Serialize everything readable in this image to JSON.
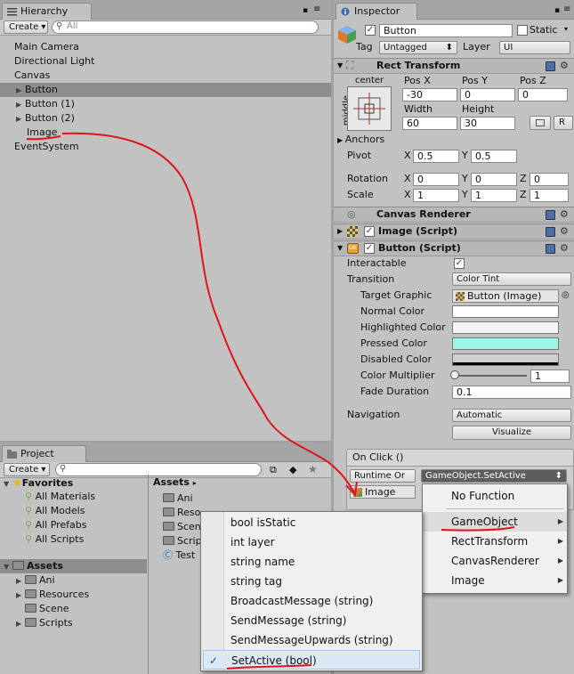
{
  "hierarchy": {
    "tab": "Hierarchy",
    "create": "Create",
    "search_placeholder": "All",
    "items": [
      {
        "label": "Main Camera"
      },
      {
        "label": "Directional Light"
      },
      {
        "label": "Canvas"
      },
      {
        "label": "Button"
      },
      {
        "label": "Button (1)"
      },
      {
        "label": "Button (2)"
      },
      {
        "label": "Image"
      },
      {
        "label": "EventSystem"
      }
    ]
  },
  "inspector": {
    "tab": "Inspector",
    "object_name": "Button",
    "static": "Static",
    "tag_label": "Tag",
    "tag_value": "Untagged",
    "layer_label": "Layer",
    "layer_value": "UI",
    "rect_transform": {
      "title": "Rect Transform",
      "anchor_h": "center",
      "anchor_v": "middle",
      "pos_x_label": "Pos X",
      "pos_y_label": "Pos Y",
      "pos_z_label": "Pos Z",
      "pos_x": "-30",
      "pos_y": "0",
      "pos_z": "0",
      "width_label": "Width",
      "height_label": "Height",
      "width": "60",
      "height": "30",
      "r_button": "R",
      "anchors": "Anchors",
      "pivot": "Pivot",
      "pivot_x": "0.5",
      "pivot_y": "0.5",
      "rotation": "Rotation",
      "rot_x": "0",
      "rot_y": "0",
      "rot_z": "0",
      "scale": "Scale",
      "scale_x": "1",
      "scale_y": "1",
      "scale_z": "1",
      "x": "X",
      "y": "Y",
      "z": "Z"
    },
    "canvas_renderer": "Canvas Renderer",
    "image_script": "Image (Script)",
    "button_script": {
      "title": "Button (Script)",
      "interactable": "Interactable",
      "transition": "Transition",
      "transition_value": "Color Tint",
      "target_graphic": "Target Graphic",
      "target_graphic_value": "Button (Image)",
      "normal_color": "Normal Color",
      "highlighted_color": "Highlighted Color",
      "pressed_color": "Pressed Color",
      "disabled_color": "Disabled Color",
      "color_multiplier": "Color Multiplier",
      "color_multiplier_value": "1",
      "fade_duration": "Fade Duration",
      "fade_duration_value": "0.1",
      "navigation": "Navigation",
      "navigation_value": "Automatic",
      "visualize": "Visualize"
    },
    "on_click": {
      "title": "On Click ()",
      "runtime": "Runtime Or",
      "function": "GameObject.SetActive",
      "target": "Image"
    }
  },
  "project": {
    "tab": "Project",
    "create": "Create",
    "favorites": "Favorites",
    "fav_items": [
      {
        "label": "All Materials"
      },
      {
        "label": "All Models"
      },
      {
        "label": "All Prefabs"
      },
      {
        "label": "All Scripts"
      }
    ],
    "assets": "Assets",
    "asset_folders": [
      {
        "label": "Ani"
      },
      {
        "label": "Resources"
      },
      {
        "label": "Scene"
      },
      {
        "label": "Scripts"
      }
    ],
    "right_header": "Assets",
    "right_items": [
      {
        "label": "Ani"
      },
      {
        "label": "Reso"
      },
      {
        "label": "Scen"
      },
      {
        "label": "Scrip"
      },
      {
        "label": "Test"
      }
    ]
  },
  "menu_main": {
    "items": [
      {
        "label": "No Function"
      },
      {
        "label": "GameObject"
      },
      {
        "label": "RectTransform"
      },
      {
        "label": "CanvasRenderer"
      },
      {
        "label": "Image"
      }
    ]
  },
  "menu_sub": {
    "items": [
      {
        "label": "bool isStatic"
      },
      {
        "label": "int layer"
      },
      {
        "label": "string name"
      },
      {
        "label": "string tag"
      },
      {
        "label": "BroadcastMessage (string)"
      },
      {
        "label": "SendMessage (string)"
      },
      {
        "label": "SendMessageUpwards (string)"
      },
      {
        "label": "SetActive (bool)"
      }
    ],
    "check": "✓"
  },
  "colors": {
    "normal": "#ffffff",
    "highlighted": "#f5f5f5",
    "pressed": "#9ff5e8",
    "disabled": "#cfcfcf",
    "annotation": "#e0141a"
  }
}
